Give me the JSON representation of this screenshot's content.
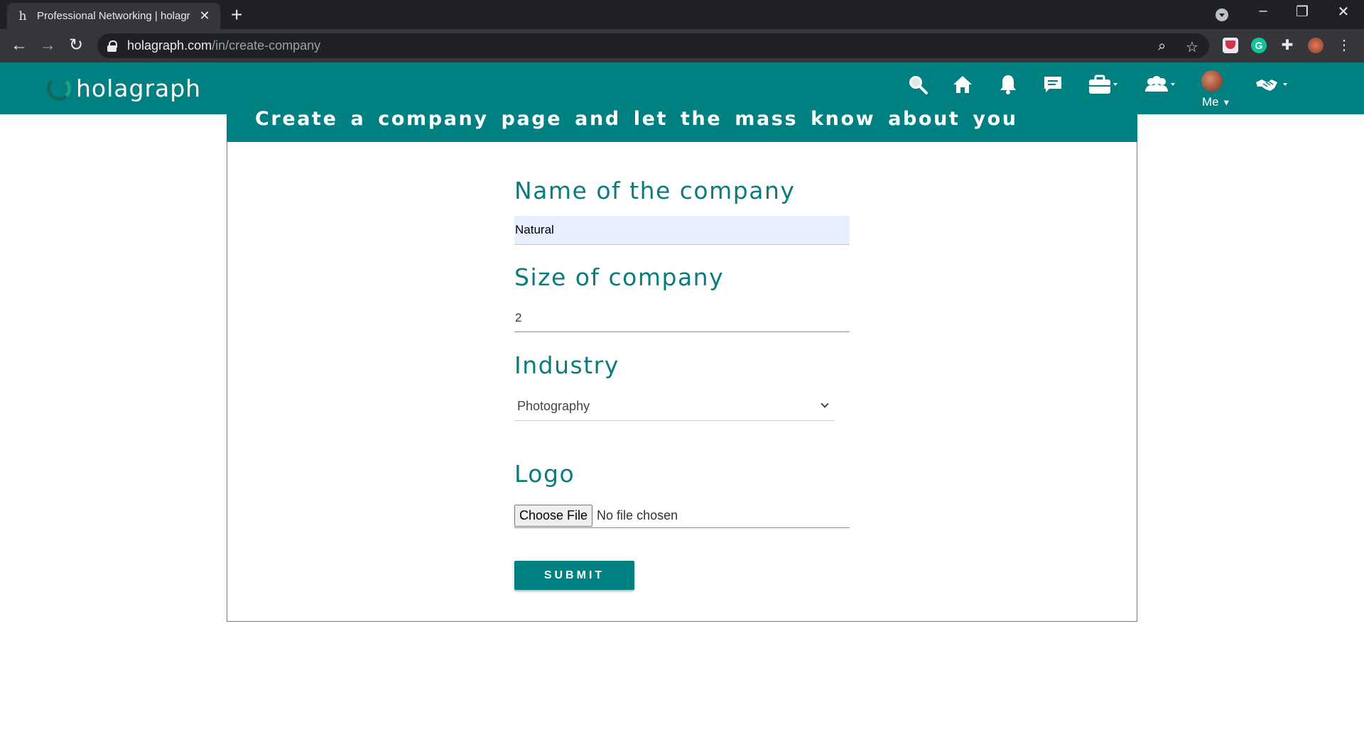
{
  "browser": {
    "tab_title": "Professional Networking | holagr",
    "tab_favicon": "h",
    "url_host": "holagraph.com",
    "url_path": "/in/create-company"
  },
  "site": {
    "logo_text": "holagraph",
    "me_label": "Me",
    "brand_color": "#008080"
  },
  "page": {
    "banner": "Create a company page and let the mass know about you",
    "fields": {
      "name_label": "Name of the company",
      "name_value": "Natural",
      "size_label": "Size of company",
      "size_value": "2",
      "industry_label": "Industry",
      "industry_value": "Photography",
      "logo_label": "Logo",
      "choose_file": "Choose File",
      "no_file": "No file chosen"
    },
    "submit": "SUBMIT"
  }
}
